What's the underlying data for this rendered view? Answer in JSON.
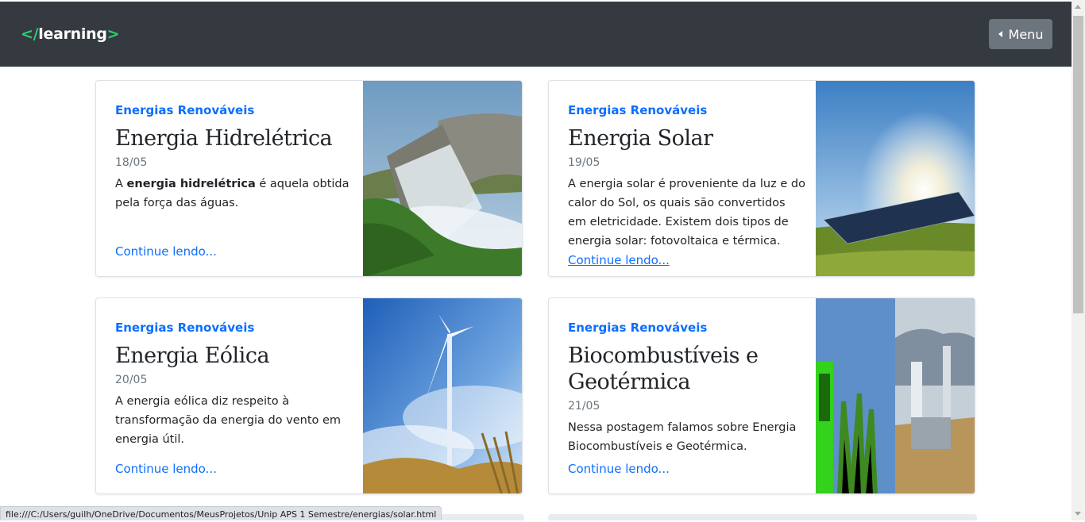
{
  "header": {
    "logo_open": "</",
    "logo_word": "learning",
    "logo_close": ">",
    "menu_label": "Menu"
  },
  "cards": [
    {
      "category": "Energias Renováveis",
      "title": "Energia Hidrelétrica",
      "date": "18/05",
      "text_before": "A ",
      "text_bold": "energia hidrelétrica",
      "text_after": " é aquela obtida pela força das águas.",
      "link": "Continue lendo...",
      "image": "hydroelectric-dam-photo"
    },
    {
      "category": "Energias Renováveis",
      "title": "Energia Solar",
      "date": "19/05",
      "text": "A energia solar é proveniente da luz e do calor do Sol, os quais são convertidos em eletricidade. Existem dois tipos de energia solar: fotovoltaica e térmica.",
      "link": "Continue lendo...",
      "image": "solar-panels-photo"
    },
    {
      "category": "Energias Renováveis",
      "title": "Energia Eólica",
      "date": "20/05",
      "text": "A energia eólica diz respeito à transformação da energia do vento em energia útil.",
      "link": "Continue lendo...",
      "image": "wind-turbine-photo"
    },
    {
      "category": "Energias Renováveis",
      "title": "Biocombustíveis e Geotérmica",
      "date": "21/05",
      "text": "Nessa postagem falamos sobre Energia Biocombustíveis e Geotérmica.",
      "link": "Continue lendo...",
      "image": "biofuel-geothermal-photo"
    }
  ],
  "status_bar": {
    "url": "file:///C:/Users/guilh/OneDrive/Documentos/MeusProjetos/Unip APS 1 Semestre/energias/solar.html"
  },
  "colors": {
    "navbar": "#343a40",
    "accent": "#0d6efd",
    "logo_bracket": "#2ecc71",
    "menu_button": "#6c757d"
  }
}
